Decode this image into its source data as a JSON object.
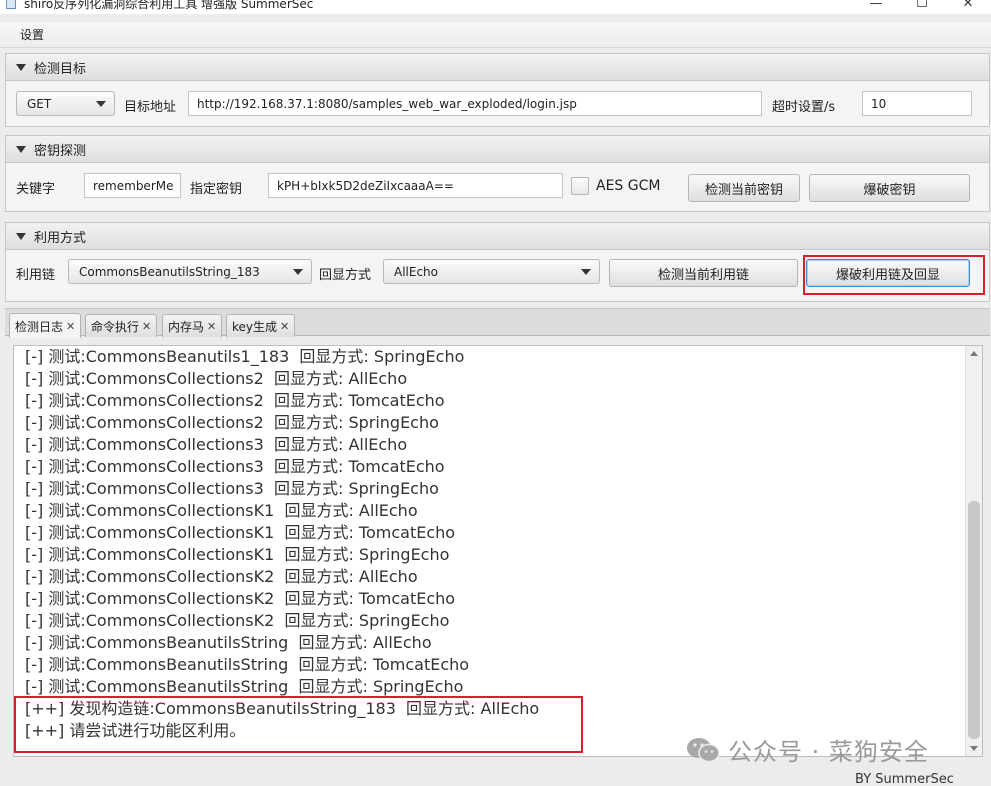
{
  "window": {
    "title": "shiro反序列化漏洞综合利用工具 增强版 SummerSec",
    "controls": [
      "—",
      "☐",
      "✕"
    ]
  },
  "menu": {
    "settings": "设置"
  },
  "target_section": {
    "header": "检测目标",
    "method": "GET",
    "url_label": "目标地址",
    "url": "http://192.168.37.1:8080/samples_web_war_exploded/login.jsp",
    "timeout_label": "超时设置/s",
    "timeout": "10"
  },
  "key_section": {
    "header": "密钥探测",
    "keyword_label": "关键字",
    "keyword": "rememberMe",
    "key_label": "指定密钥",
    "key": "kPH+bIxk5D2deZiIxcaaaA==",
    "aes_gcm_label": "AES GCM",
    "check_key_button": "检测当前密钥",
    "brute_key_button": "爆破密钥"
  },
  "exploit_section": {
    "header": "利用方式",
    "chain_label": "利用链",
    "chain": "CommonsBeanutilsString_183",
    "echo_label": "回显方式",
    "echo": "AllEcho",
    "check_chain_button": "检测当前利用链",
    "brute_chain_button": "爆破利用链及回显"
  },
  "tabs": [
    {
      "label": "检测日志"
    },
    {
      "label": "命令执行"
    },
    {
      "label": "内存马"
    },
    {
      "label": "key生成"
    }
  ],
  "tab_close_glyph": "✕",
  "log": [
    "[-] 测试:CommonsBeanutils1_183  回显方式: SpringEcho",
    "[-] 测试:CommonsCollections2  回显方式: AllEcho",
    "[-] 测试:CommonsCollections2  回显方式: TomcatEcho",
    "[-] 测试:CommonsCollections2  回显方式: SpringEcho",
    "[-] 测试:CommonsCollections3  回显方式: AllEcho",
    "[-] 测试:CommonsCollections3  回显方式: TomcatEcho",
    "[-] 测试:CommonsCollections3  回显方式: SpringEcho",
    "[-] 测试:CommonsCollectionsK1  回显方式: AllEcho",
    "[-] 测试:CommonsCollectionsK1  回显方式: TomcatEcho",
    "[-] 测试:CommonsCollectionsK1  回显方式: SpringEcho",
    "[-] 测试:CommonsCollectionsK2  回显方式: AllEcho",
    "[-] 测试:CommonsCollectionsK2  回显方式: TomcatEcho",
    "[-] 测试:CommonsCollectionsK2  回显方式: SpringEcho",
    "[-] 测试:CommonsBeanutilsString  回显方式: AllEcho",
    "[-] 测试:CommonsBeanutilsString  回显方式: TomcatEcho",
    "[-] 测试:CommonsBeanutilsString  回显方式: SpringEcho",
    "[++] 发现构造链:CommonsBeanutilsString_183  回显方式: AllEcho",
    "[++] 请尝试进行功能区利用。"
  ],
  "watermark": "公众号 · 菜狗安全",
  "footer": "BY SummerSec",
  "colors": {
    "highlight_box": "#d2232a",
    "focus_border": "#3d8fd6"
  },
  "icons": {
    "section_toggle": "triangle-down-icon",
    "dropdown": "chevron-down-icon",
    "watermark_logo": "wechat-icon"
  }
}
